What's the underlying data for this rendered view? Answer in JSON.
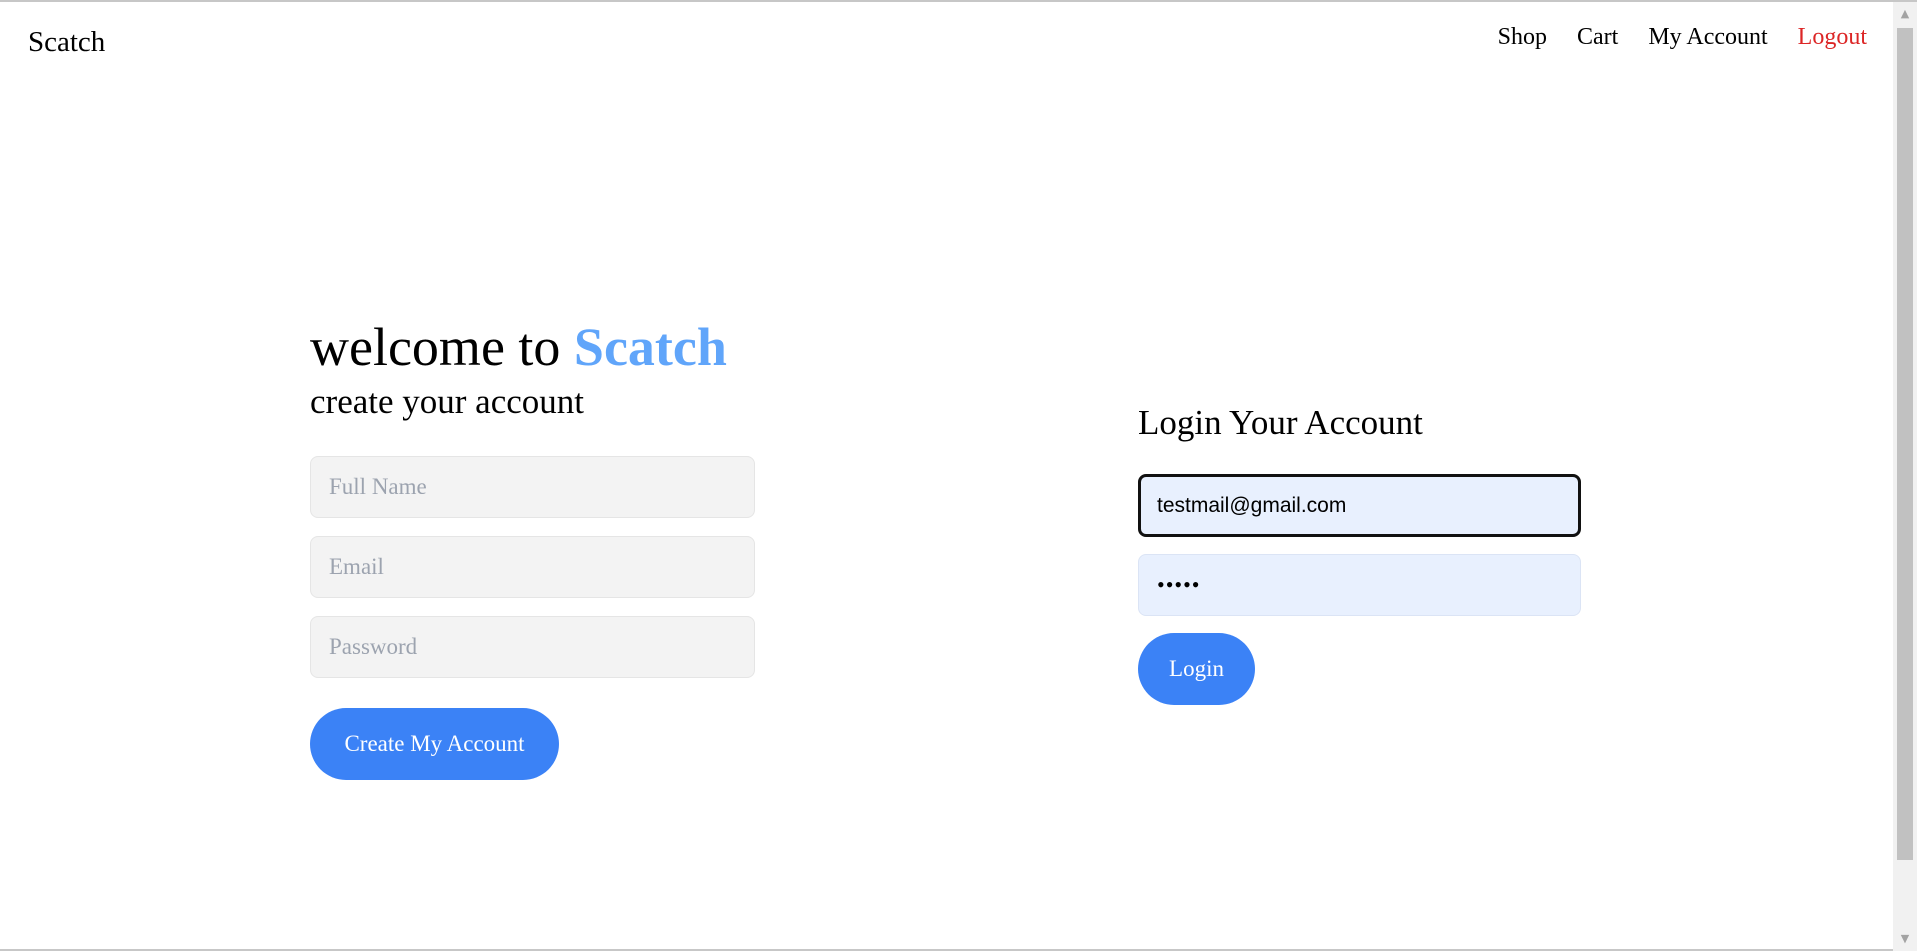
{
  "nav": {
    "brand": "Scatch",
    "links": [
      {
        "label": "Shop"
      },
      {
        "label": "Cart"
      },
      {
        "label": "My Account"
      },
      {
        "label": "Logout"
      }
    ],
    "logout_color": "#dc2626"
  },
  "register": {
    "welcome_prefix": "welcome to",
    "welcome_brand": "Scatch",
    "subtitle": "create your account",
    "full_name_placeholder": "Full Name",
    "email_placeholder": "Email",
    "password_placeholder": "Password",
    "submit_label": "Create My Account"
  },
  "login": {
    "title": "Login Your Account",
    "email_value": "testmail@gmail.com",
    "password_mask": "•••••",
    "submit_label": "Login"
  },
  "colors": {
    "accent": "#3b82f6",
    "brand_accent": "#60a5fa",
    "autofill_bg": "#e8f0fe"
  },
  "icons": {
    "scroll_up": "triangle-up",
    "scroll_down": "triangle-down"
  }
}
